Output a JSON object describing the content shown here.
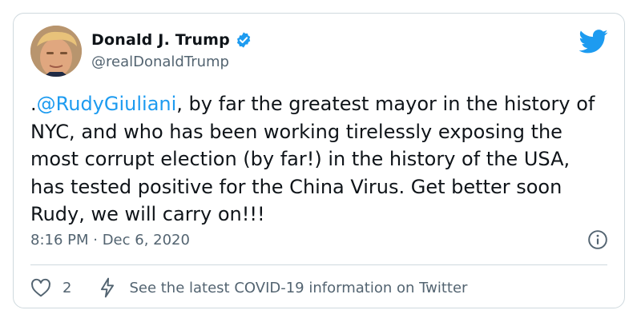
{
  "tweet": {
    "author_name": "Donald J. Trump",
    "handle": "@realDonaldTrump",
    "text_prefix": ".",
    "mention": "@RudyGiuliani",
    "text_rest": ", by far the greatest mayor in the history of NYC, and who has been working tirelessly exposing the most corrupt election (by far!) in the history of the USA, has tested positive for the China Virus. Get better soon Rudy, we will carry on!!!",
    "timestamp": "8:16 PM · Dec 6, 2020",
    "likes": "2",
    "covid_link": "See the latest COVID-19 information on Twitter"
  },
  "icons": {
    "verified": "verified-badge-icon",
    "logo": "twitter-bird-icon",
    "info": "info-icon",
    "like": "heart-icon",
    "covid": "lightning-bolt-icon"
  },
  "colors": {
    "accent": "#1d9bf0",
    "text": "#0f1419",
    "secondary": "#536471",
    "border": "#cfd9de"
  }
}
